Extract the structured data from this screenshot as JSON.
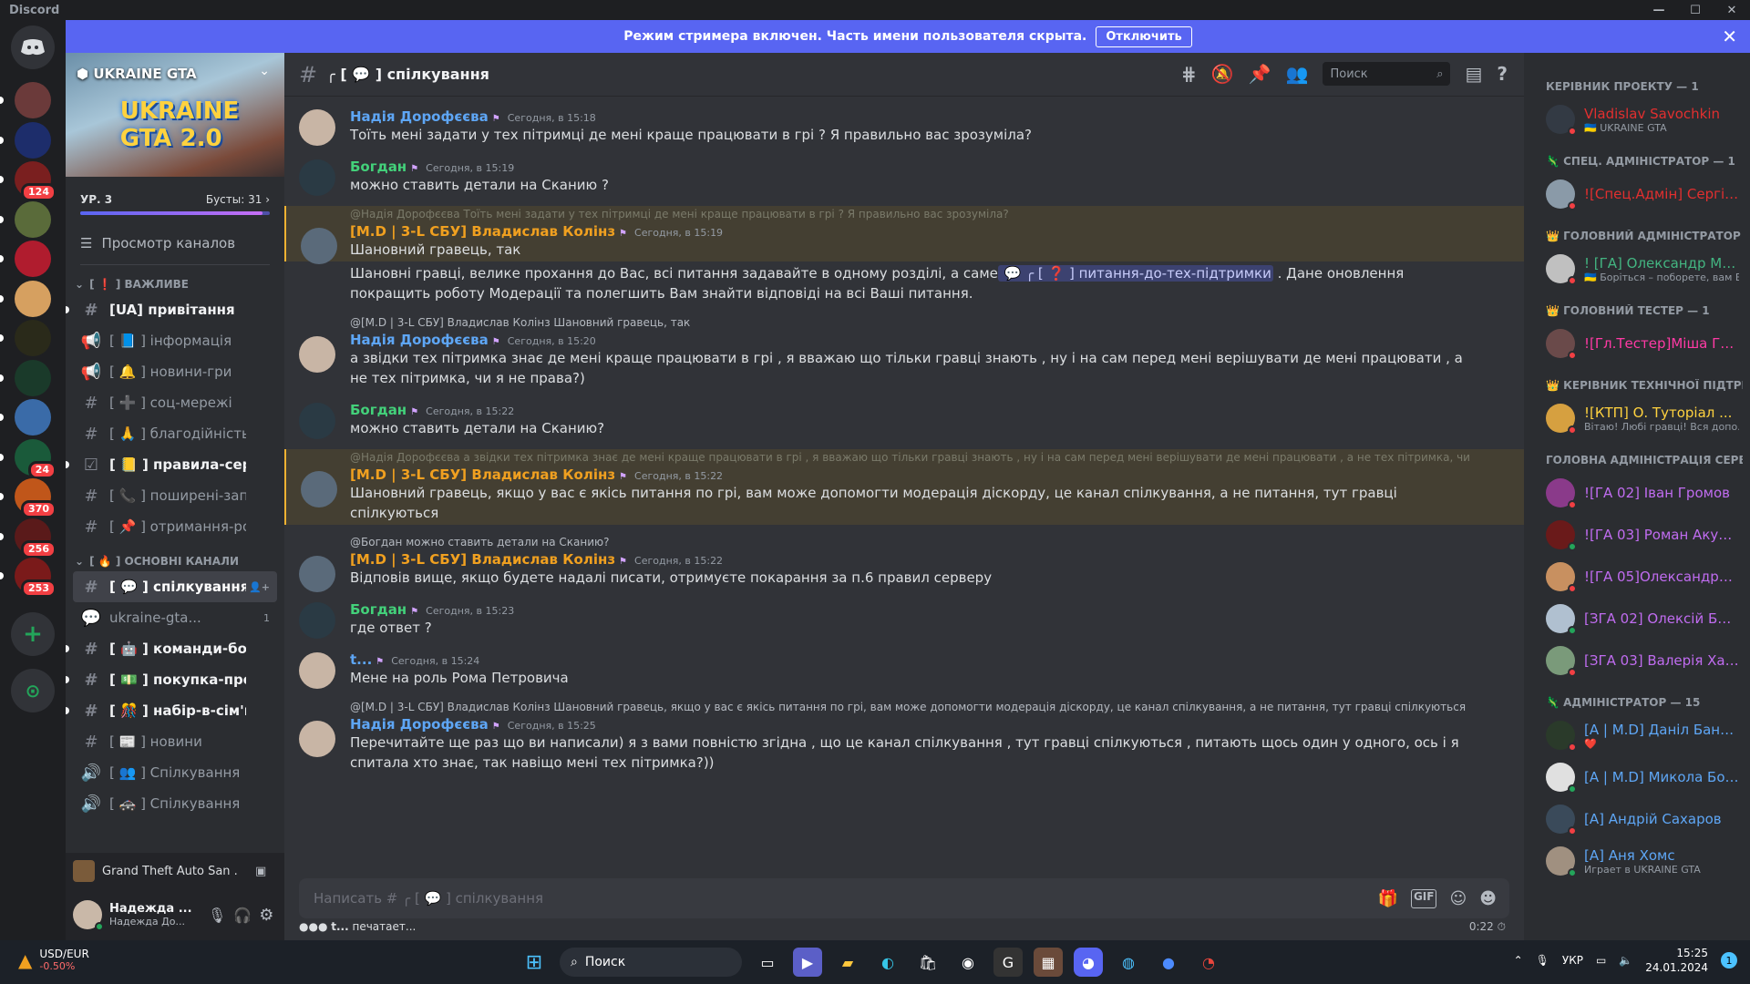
{
  "app": {
    "title": "Discord"
  },
  "banner": {
    "text": "Режим стримера включен. Часть имени пользователя скрыта.",
    "button": "Отключить"
  },
  "server_list": [
    {
      "badge": ""
    },
    {
      "badge": ""
    },
    {
      "badge": "124"
    },
    {
      "badge": ""
    },
    {
      "badge": ""
    },
    {
      "badge": ""
    },
    {
      "badge": ""
    },
    {
      "badge": ""
    },
    {
      "badge": ""
    },
    {
      "badge": "24"
    },
    {
      "badge": "370"
    },
    {
      "badge": "256"
    },
    {
      "badge": "253"
    }
  ],
  "guild": {
    "name": "UKRAINE GTA",
    "logo_text": "UKRAINE GTA 2.0",
    "level": "УР. 3",
    "boosts": "Бусты: 31"
  },
  "browse_label": "Просмотр каналов",
  "categories": {
    "important": "[ ❗ ] ВАЖЛИВЕ",
    "main": "[ 🔥 ] ОСНОВНІ КАНАЛИ"
  },
  "channels_important": [
    {
      "name": "[UA] привітання",
      "icon": "#",
      "state": "unread"
    },
    {
      "name": "[ 📘 ] інформація",
      "icon": "📢",
      "state": "read"
    },
    {
      "name": "[ 🔔 ] новини-гри",
      "icon": "📢",
      "state": "read"
    },
    {
      "name": "[ ➕ ] соц-мережі",
      "icon": "#",
      "state": "read"
    },
    {
      "name": "[ 🙏 ] благодійність",
      "icon": "#",
      "state": "read"
    },
    {
      "name": "[ 📒 ] правила-серв...",
      "icon": "☑",
      "state": "unread"
    },
    {
      "name": "[ 📞 ] поширені-зап...",
      "icon": "#",
      "state": "read"
    },
    {
      "name": "[ 📌 ] отримання-ро...",
      "icon": "#",
      "state": "read"
    }
  ],
  "channels_main": [
    {
      "name": "[ 💬 ] спілкування",
      "icon": "#",
      "state": "active",
      "count": ""
    },
    {
      "name": "ukraine-gta...",
      "icon": "💬",
      "state": "read",
      "count": "1"
    },
    {
      "name": "[ 🤖 ] команди-бота",
      "icon": "#",
      "state": "unread",
      "count": ""
    },
    {
      "name": "[ 💵 ] покупка-прод...",
      "icon": "#",
      "state": "unread",
      "count": ""
    },
    {
      "name": "[ 🎊 ] набір-в-сім'ю",
      "icon": "#",
      "state": "unread",
      "count": ""
    },
    {
      "name": "[ 📰 ] новини",
      "icon": "#",
      "state": "read",
      "count": ""
    },
    {
      "name": "[ 👥 ] Спілкування",
      "icon": "🔊",
      "state": "read",
      "count": ""
    },
    {
      "name": "[ 🚓 ] Спілкування",
      "icon": "🔊",
      "state": "read",
      "count": ""
    }
  ],
  "activity": {
    "text": "Grand Theft Auto San ..."
  },
  "user": {
    "name": "Надежда ...",
    "sub": "Надежда До..."
  },
  "chat": {
    "channel": "[ 💬 ] спілкування",
    "search_placeholder": "Поиск",
    "composer_placeholder": "Написать # ╭ [ 💬 ] спілкування",
    "typing_user": "t...",
    "typing_text": "печатает...",
    "timer": "0:22"
  },
  "messages": [
    {
      "author": "Надія Дорофєєва",
      "color": "#5ea6f5",
      "time": "Сегодня, в 15:18",
      "reply": "",
      "hl": false,
      "text": "Тоїть мені задати у тех пітримці де мені краще працювати в грі ? Я правильно вас зрозуміла?"
    },
    {
      "author": "Богдан",
      "color": "#43d17a",
      "time": "Сегодня, в 15:19",
      "reply": "",
      "hl": false,
      "text": "можно ставить детали на Сканию ?"
    },
    {
      "author": "[M.D | 3-L СБУ] Владислав Колінз",
      "color": "#f0a020",
      "time": "Сегодня, в 15:19",
      "reply": "@Надія Дорофєєва Тоїть мені задати у тех пітримці де мені краще працювати в грі ? Я правильно вас зрозуміла?",
      "hl": true,
      "text": "Шановний гравець, так"
    },
    {
      "author": "",
      "color": "",
      "time": "",
      "reply": "",
      "hl": false,
      "text": "Шановні гравці, велике прохання до Вас, всі питання задавайте в одному розділі, а саме",
      "mention": "╭ [ ❓ ] питання-до-тех-підтримки",
      "text2": ". Дане оновлення покращить роботу Модерації та полегшить Вам знайти відповіді на всі Ваші питання."
    },
    {
      "author": "Надія Дорофєєва",
      "color": "#5ea6f5",
      "time": "Сегодня, в 15:20",
      "reply": "@[M.D | 3-L СБУ] Владислав Колінз Шановний гравець, так",
      "hl": false,
      "text": "а звідки тех пітримка знає де мені краще працювати в грі , я вважаю що тільки гравці знають , ну і на сам перед мені верішувати де мені працювати , а не тех пітримка, чи я не права?)"
    },
    {
      "author": "Богдан",
      "color": "#43d17a",
      "time": "Сегодня, в 15:22",
      "reply": "",
      "hl": false,
      "text": "можно ставить детали на Сканию?"
    },
    {
      "author": "[M.D | 3-L СБУ] Владислав Колінз",
      "color": "#f0a020",
      "time": "Сегодня, в 15:22",
      "reply": "@Надія Дорофєєва а звідки тех пітримка знає де мені краще працювати в грі , я вважаю що тільки гравці знають , ну і на сам перед мені верішувати де мені працювати , а не тех пітримка, чи я не пра",
      "hl": true,
      "text": "Шановний гравець, якщо у вас є якісь питання по грі, вам може допомогти модерація діскорду, це канал спілкування, а не питання, тут гравці спілкуються"
    },
    {
      "author": "[M.D | 3-L СБУ] Владислав Колінз",
      "color": "#f0a020",
      "time": "Сегодня, в 15:22",
      "reply": "@Богдан можно ставить детали на Сканию?",
      "hl": false,
      "text": "Відповів вище, якщо будете надалі писати, отримуєте покарання за п.6 правил серверу"
    },
    {
      "author": "Богдан",
      "color": "#43d17a",
      "time": "Сегодня, в 15:23",
      "reply": "",
      "hl": false,
      "text": "где ответ ?"
    },
    {
      "author": "t...",
      "color": "#5ea6f5",
      "time": "Сегодня, в 15:24",
      "reply": "",
      "hl": false,
      "text": "Мене на роль Рома Петровича"
    },
    {
      "author": "Надія Дорофєєва",
      "color": "#5ea6f5",
      "time": "Сегодня, в 15:25",
      "reply": "@[M.D | 3-L СБУ] Владислав Колінз Шановний гравець, якщо у вас є якісь питання по грі, вам може допомогти модерація діскорду, це канал спілкування, а не питання, тут гравці спілкуються",
      "hl": false,
      "text": "Перечитайте ще раз що ви написали) я з вами повністю згідна , що це канал спілкування , тут гравці спілкуються , питають щось один у одного, ось і я спитала хто знає, так навіщо мені тех пітримка?))"
    }
  ],
  "members": [
    {
      "cat": "КЕРІВНИК ПРОЕКТУ — 1",
      "items": [
        {
          "name": "Vladislav Savochkin",
          "sub": "🇺🇦 UKRAINE GTA",
          "color": "#e22f2f"
        }
      ]
    },
    {
      "cat": "🦎 СПЕЦ. АДМІНІСТРАТОР — 1",
      "items": [
        {
          "name": "![Спец.Адмін] Сергій ...",
          "sub": "",
          "color": "#e22f2f"
        }
      ]
    },
    {
      "cat": "👑 ГОЛОВНИЙ АДМІНІСТРАТОР — 1",
      "items": [
        {
          "name": "! [ГА] Олександр Мір...",
          "sub": "🇺🇦 Боріться – поборете, вам Б...",
          "color": "#43b581"
        }
      ]
    },
    {
      "cat": "👑 ГОЛОВНИЙ ТЕСТЕР — 1",
      "items": [
        {
          "name": "![Гл.Тестер]Міша Гол...",
          "sub": "",
          "color": "#ff3aa5"
        }
      ]
    },
    {
      "cat": "👑 КЕРІВНИК ТЕХНІЧНОЇ ПІДТРИ...",
      "items": [
        {
          "name": "![КТП] О. Туторіал ...",
          "sub": "Вітаю! Любі гравці! Вся допо...",
          "color": "#ffd23f"
        }
      ]
    },
    {
      "cat": "ГОЛОВНА АДМІНІСТРАЦІЯ СЕРВЕ...",
      "items": [
        {
          "name": "![ГА 02] Іван Громов",
          "sub": "",
          "color": "#c06cf0"
        },
        {
          "name": "![ГА 03] Роман Акуле...",
          "sub": "",
          "color": "#c06cf0"
        },
        {
          "name": "![ГА 05]Олександра ...",
          "sub": "",
          "color": "#c06cf0"
        },
        {
          "name": "[ЗГА 02] Олексій Без...",
          "sub": "",
          "color": "#c06cf0"
        },
        {
          "name": "[ЗГА 03] Валерія Хар...",
          "sub": "",
          "color": "#c06cf0"
        }
      ]
    },
    {
      "cat": "🦎 АДМІНІСТРАТОР — 15",
      "items": [
        {
          "name": "[A | M.D] Даніл Бане...",
          "sub": "❤️",
          "color": "#5ea6f5"
        },
        {
          "name": "[A | M.D] Микола Бог...",
          "sub": "",
          "color": "#5ea6f5"
        },
        {
          "name": "[A] Андрій Сахаров",
          "sub": "",
          "color": "#5ea6f5"
        },
        {
          "name": "[A] Аня Хомс",
          "sub": "Играет в UKRAINE GTA",
          "color": "#5ea6f5"
        }
      ]
    }
  ],
  "taskbar": {
    "ticker": "USD/EUR",
    "ticker_change": "-0.50%",
    "search": "Поиск",
    "lang": "УКР",
    "time": "15:25",
    "date": "24.01.2024",
    "notif": "1"
  },
  "colors": {
    "blurple": "#5865f2",
    "bg": "#313338",
    "sidebar": "#2b2d31",
    "highlight": "#443f32"
  }
}
